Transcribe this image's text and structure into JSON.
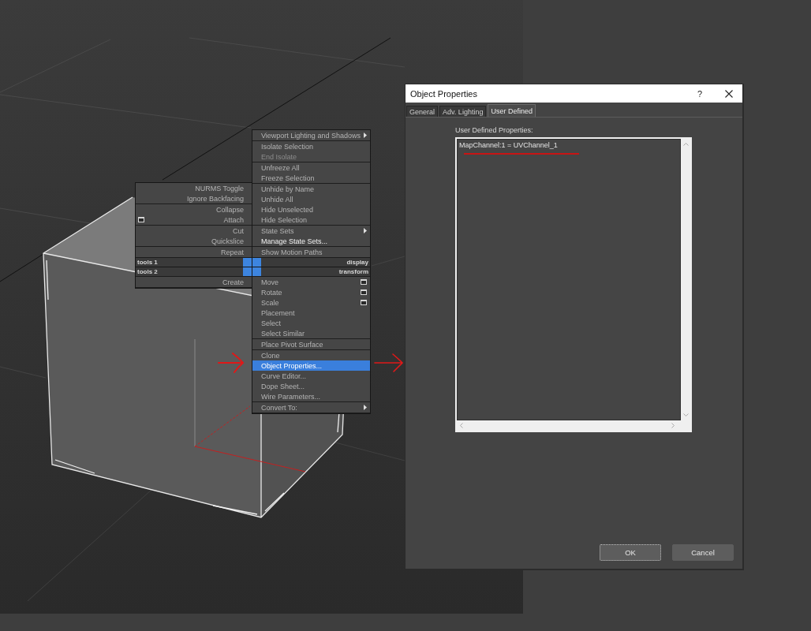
{
  "quad_menu": {
    "top_left": {
      "title": "tools 1",
      "groups": [
        [
          {
            "label": "NURMS Toggle",
            "selected": false,
            "disabled": false,
            "emphasized": false,
            "submenu": false,
            "options": false
          },
          {
            "label": "Ignore Backfacing",
            "selected": false,
            "disabled": false,
            "emphasized": false,
            "submenu": false,
            "options": false
          }
        ],
        [
          {
            "label": "Collapse",
            "selected": false,
            "disabled": false,
            "emphasized": false,
            "submenu": false,
            "options": false
          },
          {
            "label": "Attach",
            "selected": false,
            "disabled": false,
            "emphasized": false,
            "submenu": false,
            "options": true
          }
        ],
        [
          {
            "label": "Cut",
            "selected": false,
            "disabled": false,
            "emphasized": false,
            "submenu": false,
            "options": false
          },
          {
            "label": "Quickslice",
            "selected": false,
            "disabled": false,
            "emphasized": false,
            "submenu": false,
            "options": false
          }
        ],
        [
          {
            "label": "Repeat",
            "selected": false,
            "disabled": false,
            "emphasized": false,
            "submenu": false,
            "options": false
          }
        ]
      ]
    },
    "bottom_left": {
      "title": "tools 2",
      "groups": [
        [
          {
            "label": "Create",
            "selected": false,
            "disabled": false,
            "emphasized": false,
            "submenu": false,
            "options": false
          }
        ]
      ]
    },
    "top_right": {
      "title": "display",
      "groups": [
        [
          {
            "label": "Viewport Lighting and Shadows",
            "selected": false,
            "disabled": false,
            "emphasized": false,
            "submenu": true,
            "options": false
          }
        ],
        [
          {
            "label": "Isolate Selection",
            "selected": false,
            "disabled": false,
            "emphasized": false,
            "submenu": false,
            "options": false
          },
          {
            "label": "End Isolate",
            "selected": false,
            "disabled": true,
            "emphasized": false,
            "submenu": false,
            "options": false
          }
        ],
        [
          {
            "label": "Unfreeze All",
            "selected": false,
            "disabled": false,
            "emphasized": false,
            "submenu": false,
            "options": false
          },
          {
            "label": "Freeze Selection",
            "selected": false,
            "disabled": false,
            "emphasized": false,
            "submenu": false,
            "options": false
          }
        ],
        [
          {
            "label": "Unhide by Name",
            "selected": false,
            "disabled": false,
            "emphasized": false,
            "submenu": false,
            "options": false
          },
          {
            "label": "Unhide All",
            "selected": false,
            "disabled": false,
            "emphasized": false,
            "submenu": false,
            "options": false
          },
          {
            "label": "Hide Unselected",
            "selected": false,
            "disabled": false,
            "emphasized": false,
            "submenu": false,
            "options": false
          },
          {
            "label": "Hide Selection",
            "selected": false,
            "disabled": false,
            "emphasized": false,
            "submenu": false,
            "options": false
          }
        ],
        [
          {
            "label": "State Sets",
            "selected": false,
            "disabled": false,
            "emphasized": false,
            "submenu": true,
            "options": false
          },
          {
            "label": "Manage State Sets...",
            "selected": false,
            "disabled": false,
            "emphasized": true,
            "submenu": false,
            "options": false
          }
        ],
        [
          {
            "label": "Show Motion Paths",
            "selected": false,
            "disabled": false,
            "emphasized": false,
            "submenu": false,
            "options": false
          }
        ]
      ]
    },
    "bottom_right": {
      "title": "transform",
      "groups": [
        [
          {
            "label": "Move",
            "selected": false,
            "disabled": false,
            "emphasized": false,
            "submenu": false,
            "options": true
          },
          {
            "label": "Rotate",
            "selected": false,
            "disabled": false,
            "emphasized": false,
            "submenu": false,
            "options": true
          },
          {
            "label": "Scale",
            "selected": false,
            "disabled": false,
            "emphasized": false,
            "submenu": false,
            "options": true
          },
          {
            "label": "Placement",
            "selected": false,
            "disabled": false,
            "emphasized": false,
            "submenu": false,
            "options": false
          },
          {
            "label": "Select",
            "selected": false,
            "disabled": false,
            "emphasized": false,
            "submenu": false,
            "options": false
          },
          {
            "label": "Select Similar",
            "selected": false,
            "disabled": false,
            "emphasized": false,
            "submenu": false,
            "options": false
          }
        ],
        [
          {
            "label": "Place Pivot Surface",
            "selected": false,
            "disabled": false,
            "emphasized": false,
            "submenu": false,
            "options": false
          }
        ],
        [
          {
            "label": "Clone",
            "selected": false,
            "disabled": false,
            "emphasized": false,
            "submenu": false,
            "options": false
          },
          {
            "label": "Object Properties...",
            "selected": true,
            "disabled": false,
            "emphasized": false,
            "submenu": false,
            "options": false
          },
          {
            "label": "Curve Editor...",
            "selected": false,
            "disabled": false,
            "emphasized": false,
            "submenu": false,
            "options": false
          },
          {
            "label": "Dope Sheet...",
            "selected": false,
            "disabled": false,
            "emphasized": false,
            "submenu": false,
            "options": false
          },
          {
            "label": "Wire Parameters...",
            "selected": false,
            "disabled": false,
            "emphasized": false,
            "submenu": false,
            "options": false
          }
        ],
        [
          {
            "label": "Convert To:",
            "selected": false,
            "disabled": false,
            "emphasized": false,
            "submenu": true,
            "options": false
          }
        ]
      ]
    }
  },
  "dialog": {
    "title": "Object Properties",
    "help_button": "?",
    "tabs": [
      {
        "label": "General",
        "selected": false
      },
      {
        "label": "Adv. Lighting",
        "selected": false
      },
      {
        "label": "User Defined",
        "selected": true
      }
    ],
    "properties_label": "User Defined Properties:",
    "properties_text": "MapChannel:1 = UVChannel_1",
    "buttons": [
      {
        "label": "OK",
        "focused": true
      },
      {
        "label": "Cancel",
        "focused": false
      }
    ]
  }
}
